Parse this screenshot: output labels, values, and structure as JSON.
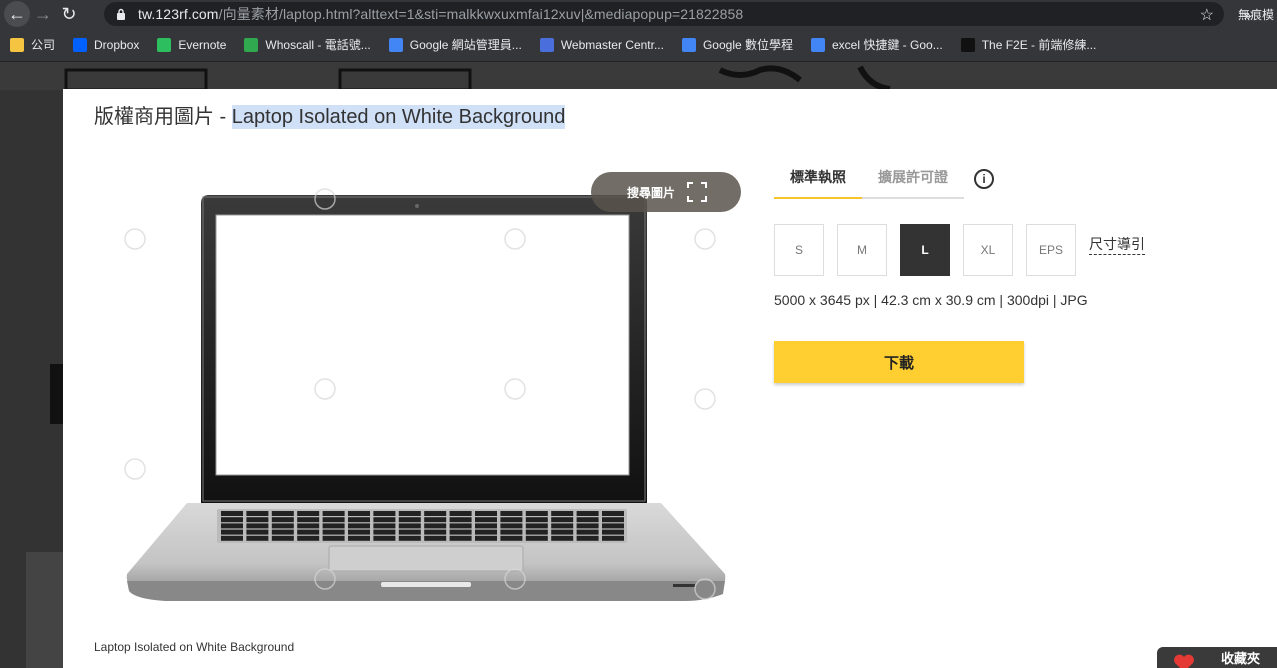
{
  "browser": {
    "url_host": "tw.123rf.com",
    "url_rest": "/向量素材/laptop.html?alttext=1&sti=malkkwxuxmfai12xuv|&mediapopup=21822858",
    "profile_label": "無痕模"
  },
  "bookmarks": [
    {
      "label": "公司",
      "icon": "folder-icon",
      "color": "#f5c542"
    },
    {
      "label": "Dropbox",
      "icon": "dropbox-icon",
      "color": "#0061ff"
    },
    {
      "label": "Evernote",
      "icon": "evernote-icon",
      "color": "#2dbe60"
    },
    {
      "label": "Whoscall - 電話號...",
      "icon": "whoscall-icon",
      "color": "#2fa84f"
    },
    {
      "label": "Google 網站管理員...",
      "icon": "google-icon",
      "color": "#4285f4"
    },
    {
      "label": "Webmaster Centr...",
      "icon": "webmaster-icon",
      "color": "#4a6fdc"
    },
    {
      "label": "Google 數位學程",
      "icon": "google-icon",
      "color": "#4285f4"
    },
    {
      "label": "excel 快捷鍵 - Goo...",
      "icon": "google-icon",
      "color": "#4285f4"
    },
    {
      "label": "The F2E - 前端修練...",
      "icon": "f2e-icon",
      "color": "#111111"
    }
  ],
  "bookmarks_more": "»",
  "modal": {
    "title_prefix": "版權商用圖片 - ",
    "title_highlight": "Laptop Isolated on White Background",
    "search_image_label": "搜尋圖片",
    "caption": "Laptop Isolated on White Background"
  },
  "license_tabs": [
    {
      "label": "標準執照",
      "active": true
    },
    {
      "label": "擴展許可證",
      "active": false
    }
  ],
  "info_label": "i",
  "sizes": [
    {
      "label": "S",
      "selected": false
    },
    {
      "label": "M",
      "selected": false
    },
    {
      "label": "L",
      "selected": true
    },
    {
      "label": "XL",
      "selected": false
    },
    {
      "label": "EPS",
      "selected": false
    }
  ],
  "size_guide_label": "尺寸導引",
  "spec": "5000 x 3645 px | 42.3 cm x 30.9 cm | 300dpi | JPG",
  "download_label": "下載",
  "favorite_label": "收藏夾",
  "colors": {
    "accent": "#ffcf32",
    "selected_size": "#333333",
    "highlight": "#cfe0f7"
  }
}
